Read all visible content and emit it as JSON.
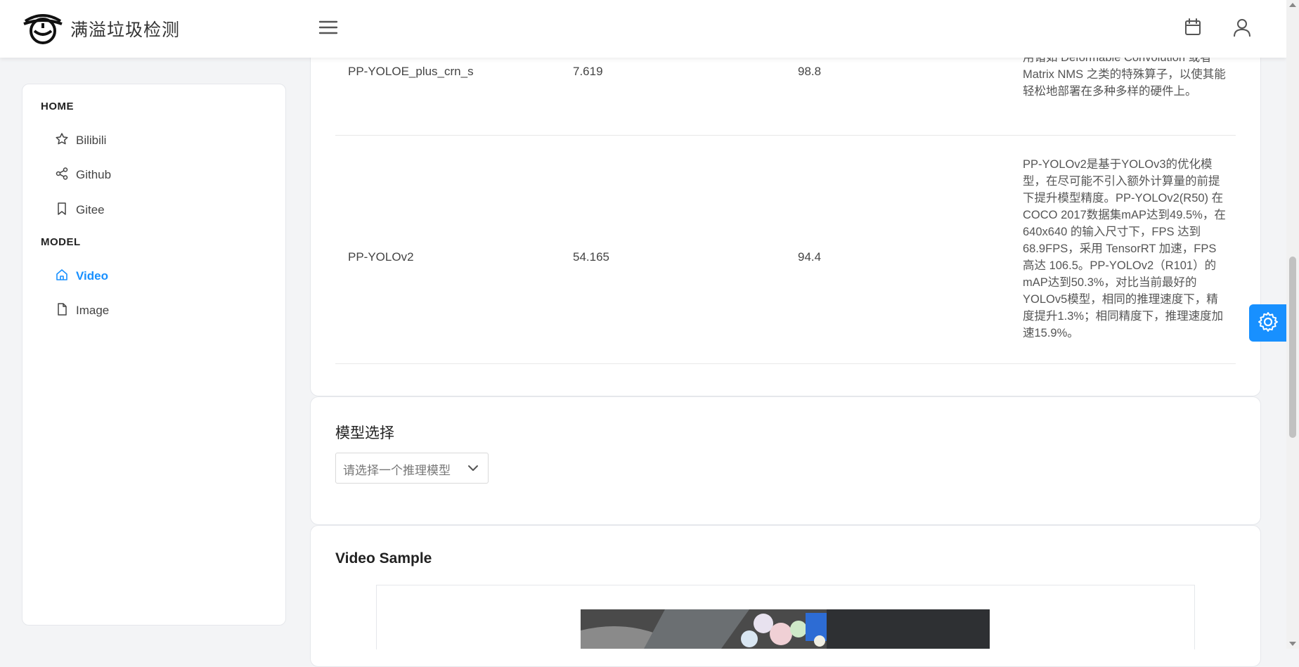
{
  "header": {
    "title": "满溢垃圾检测",
    "icons": [
      "logo-icon",
      "menu-icon",
      "calendar-icon",
      "user-icon"
    ]
  },
  "sidebar": {
    "sections": [
      {
        "title": "HOME",
        "items": [
          {
            "label": "Bilibili",
            "icon": "star-icon"
          },
          {
            "label": "Github",
            "icon": "share-icon"
          },
          {
            "label": "Gitee",
            "icon": "bookmark-icon"
          }
        ]
      },
      {
        "title": "MODEL",
        "items": [
          {
            "label": "Video",
            "icon": "home-icon",
            "active": true
          },
          {
            "label": "Image",
            "icon": "file-icon"
          }
        ]
      }
    ]
  },
  "model_table": {
    "rows": [
      {
        "name": "PP-YOLOE_plus_crn_s",
        "col2": "7.619",
        "col3": "98.8",
        "description": "的 YOLO 模型。PP-YOLOE 避免了使用诸如 Deformable Convolution 或者 Matrix NMS 之类的特殊算子，以使其能轻松地部署在多种多样的硬件上。"
      },
      {
        "name": "PP-YOLOv2",
        "col2": "54.165",
        "col3": "94.4",
        "description": "PP-YOLOv2是基于YOLOv3的优化模型，在尽可能不引入额外计算量的前提下提升模型精度。PP-YOLOv2(R50) 在COCO 2017数据集mAP达到49.5%，在 640x640 的输入尺寸下，FPS 达到 68.9FPS，采用 TensorRT 加速，FPS 高达 106.5。PP-YOLOv2（R101）的mAP达到50.3%，对比当前最好的YOLOv5模型，相同的推理速度下，精度提升1.3%；相同精度下，推理速度加速15.9%。"
      }
    ]
  },
  "model_select": {
    "title": "模型选择",
    "placeholder": "请选择一个推理模型"
  },
  "video": {
    "title": "Video Sample"
  },
  "colors": {
    "accent": "#1890ff",
    "background": "#f3f4f6"
  }
}
